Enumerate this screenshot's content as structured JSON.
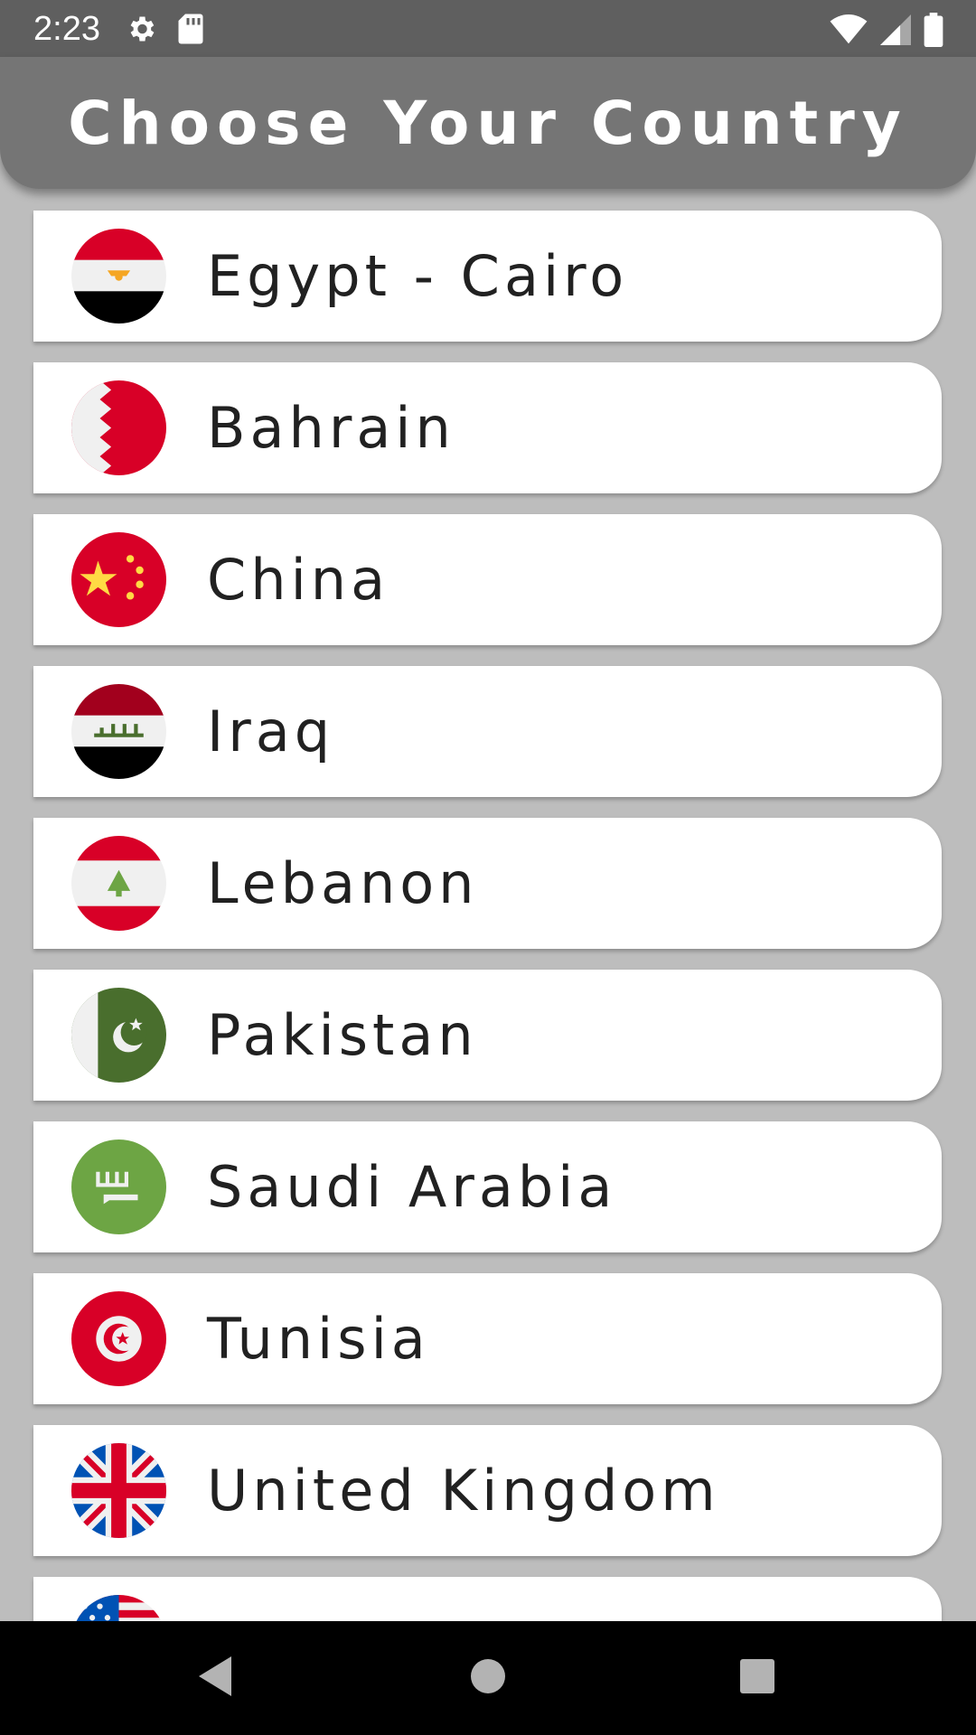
{
  "status_bar": {
    "time": "2:23",
    "left_icons": [
      "gear-icon",
      "sd-card-icon"
    ],
    "right_icons": [
      "wifi-icon",
      "signal-icon",
      "battery-icon"
    ]
  },
  "header": {
    "title": "Choose Your Country",
    "background": "#757575"
  },
  "countries": [
    {
      "name": "Egypt - Cairo",
      "flag": "egypt-flag-icon"
    },
    {
      "name": "Bahrain",
      "flag": "bahrain-flag-icon"
    },
    {
      "name": "China",
      "flag": "china-flag-icon"
    },
    {
      "name": "Iraq",
      "flag": "iraq-flag-icon"
    },
    {
      "name": "Lebanon",
      "flag": "lebanon-flag-icon"
    },
    {
      "name": "Pakistan",
      "flag": "pakistan-flag-icon"
    },
    {
      "name": "Saudi Arabia",
      "flag": "saudi-arabia-flag-icon"
    },
    {
      "name": "Tunisia",
      "flag": "tunisia-flag-icon"
    },
    {
      "name": "United Kingdom",
      "flag": "united-kingdom-flag-icon"
    },
    {
      "name": "",
      "flag": "united-states-flag-icon"
    }
  ],
  "nav_bar": {
    "buttons": [
      "back-icon",
      "home-icon",
      "recents-icon"
    ]
  },
  "colors": {
    "list_background": "#bdbdbd",
    "card_background": "#ffffff",
    "status_bar": "#5f5f5f"
  }
}
